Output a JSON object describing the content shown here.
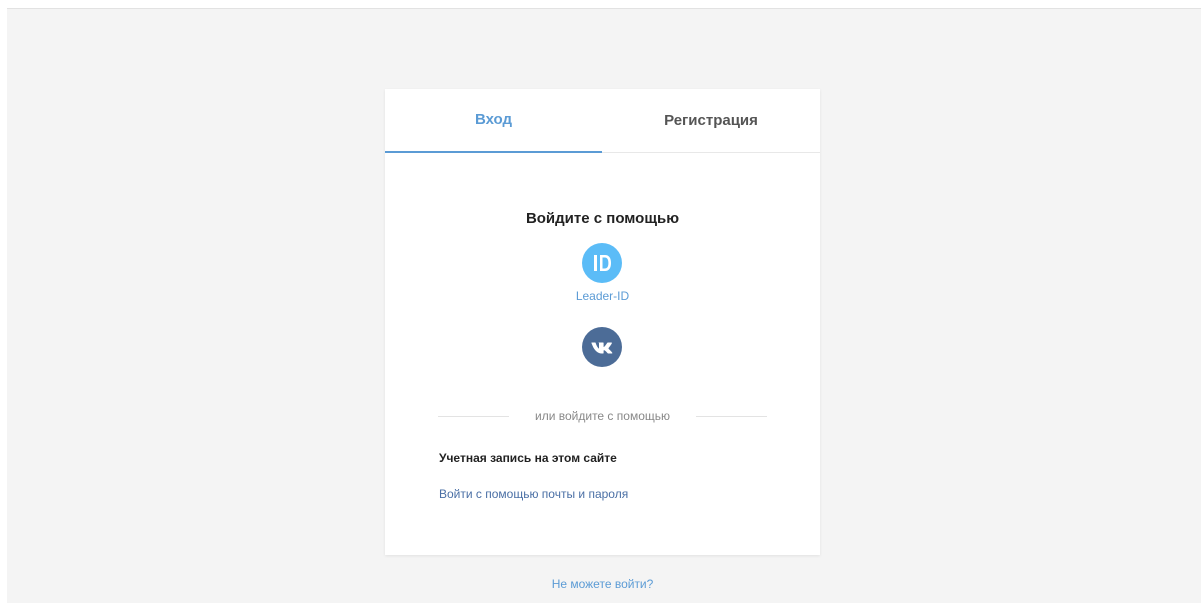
{
  "tabs": {
    "login": "Вход",
    "register": "Регистрация"
  },
  "social": {
    "heading": "Войдите с помощью",
    "leader_id": {
      "icon": "leader-id-icon",
      "label": "Leader-ID",
      "color": "#5bbcf7"
    },
    "vk": {
      "icon": "vk-icon",
      "color": "#4c6c97"
    }
  },
  "divider": {
    "text": "или войдите с помощью"
  },
  "account": {
    "label": "Учетная запись на этом сайте",
    "link": "Войти с помощью почты и пароля"
  },
  "help": {
    "link": "Не можете войти?"
  },
  "colors": {
    "accent": "#5b9bd5",
    "background": "#f4f4f4"
  }
}
